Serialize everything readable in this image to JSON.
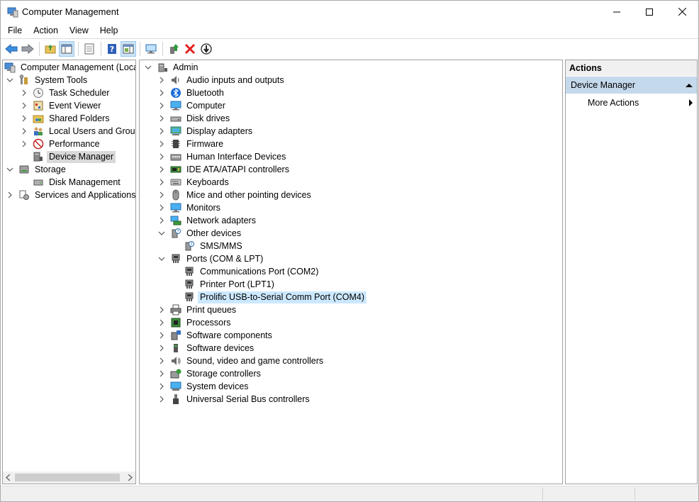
{
  "window": {
    "title": "Computer Management"
  },
  "menu": [
    "File",
    "Action",
    "View",
    "Help"
  ],
  "toolbar": {
    "icons": [
      "back-arrow-icon",
      "forward-arrow-icon",
      "up-folder-icon",
      "show-hide-tree-icon",
      "properties-icon",
      "help-icon",
      "show-hide-action-pane-icon",
      "monitor-icon",
      "update-driver-icon",
      "uninstall-icon",
      "disable-icon"
    ]
  },
  "left_tree": {
    "root": "Computer Management (Local",
    "items": [
      {
        "label": "System Tools",
        "level": 1,
        "expander": "open",
        "icon": "tools-icon"
      },
      {
        "label": "Task Scheduler",
        "level": 2,
        "expander": "closed",
        "icon": "clock-icon"
      },
      {
        "label": "Event Viewer",
        "level": 2,
        "expander": "closed",
        "icon": "event-log-icon"
      },
      {
        "label": "Shared Folders",
        "level": 2,
        "expander": "closed",
        "icon": "shared-folder-icon"
      },
      {
        "label": "Local Users and Groups",
        "level": 2,
        "expander": "closed",
        "icon": "users-icon"
      },
      {
        "label": "Performance",
        "level": 2,
        "expander": "closed",
        "icon": "performance-icon"
      },
      {
        "label": "Device Manager",
        "level": 2,
        "expander": "none",
        "icon": "device-manager-icon",
        "selected": true
      },
      {
        "label": "Storage",
        "level": 1,
        "expander": "open",
        "icon": "storage-icon"
      },
      {
        "label": "Disk Management",
        "level": 2,
        "expander": "none",
        "icon": "disk-icon"
      },
      {
        "label": "Services and Applications",
        "level": 1,
        "expander": "closed",
        "icon": "services-icon"
      }
    ]
  },
  "device_tree": {
    "root": "Admin",
    "items": [
      {
        "label": "Audio inputs and outputs",
        "level": 1,
        "expander": "closed",
        "icon": "speaker-icon"
      },
      {
        "label": "Bluetooth",
        "level": 1,
        "expander": "closed",
        "icon": "bluetooth-icon"
      },
      {
        "label": "Computer",
        "level": 1,
        "expander": "closed",
        "icon": "computer-icon"
      },
      {
        "label": "Disk drives",
        "level": 1,
        "expander": "closed",
        "icon": "disk-drive-icon"
      },
      {
        "label": "Display adapters",
        "level": 1,
        "expander": "closed",
        "icon": "display-adapter-icon"
      },
      {
        "label": "Firmware",
        "level": 1,
        "expander": "closed",
        "icon": "firmware-icon"
      },
      {
        "label": "Human Interface Devices",
        "level": 1,
        "expander": "closed",
        "icon": "hid-icon"
      },
      {
        "label": "IDE ATA/ATAPI controllers",
        "level": 1,
        "expander": "closed",
        "icon": "ide-controller-icon"
      },
      {
        "label": "Keyboards",
        "level": 1,
        "expander": "closed",
        "icon": "keyboard-icon"
      },
      {
        "label": "Mice and other pointing devices",
        "level": 1,
        "expander": "closed",
        "icon": "mouse-icon"
      },
      {
        "label": "Monitors",
        "level": 1,
        "expander": "closed",
        "icon": "monitor-icon"
      },
      {
        "label": "Network adapters",
        "level": 1,
        "expander": "closed",
        "icon": "network-adapter-icon"
      },
      {
        "label": "Other devices",
        "level": 1,
        "expander": "open",
        "icon": "other-devices-icon"
      },
      {
        "label": "SMS/MMS",
        "level": 2,
        "expander": "none",
        "icon": "unknown-device-icon"
      },
      {
        "label": "Ports (COM & LPT)",
        "level": 1,
        "expander": "open",
        "icon": "port-icon"
      },
      {
        "label": "Communications Port (COM2)",
        "level": 2,
        "expander": "none",
        "icon": "port-icon"
      },
      {
        "label": "Printer Port (LPT1)",
        "level": 2,
        "expander": "none",
        "icon": "port-icon"
      },
      {
        "label": "Prolific USB-to-Serial Comm Port (COM4)",
        "level": 2,
        "expander": "none",
        "icon": "port-icon",
        "selected": true
      },
      {
        "label": "Print queues",
        "level": 1,
        "expander": "closed",
        "icon": "printer-icon"
      },
      {
        "label": "Processors",
        "level": 1,
        "expander": "closed",
        "icon": "processor-icon"
      },
      {
        "label": "Software components",
        "level": 1,
        "expander": "closed",
        "icon": "software-component-icon"
      },
      {
        "label": "Software devices",
        "level": 1,
        "expander": "closed",
        "icon": "software-device-icon"
      },
      {
        "label": "Sound, video and game controllers",
        "level": 1,
        "expander": "closed",
        "icon": "sound-icon"
      },
      {
        "label": "Storage controllers",
        "level": 1,
        "expander": "closed",
        "icon": "storage-controller-icon"
      },
      {
        "label": "System devices",
        "level": 1,
        "expander": "closed",
        "icon": "system-device-icon"
      },
      {
        "label": "Universal Serial Bus controllers",
        "level": 1,
        "expander": "closed",
        "icon": "usb-icon"
      }
    ]
  },
  "actions": {
    "header": "Actions",
    "section": "Device Manager",
    "items": [
      "More Actions"
    ]
  },
  "colors": {
    "selection": "#cce8ff",
    "actions_section": "#c5d9ec",
    "inactive_selection": "#d9d9d9"
  }
}
